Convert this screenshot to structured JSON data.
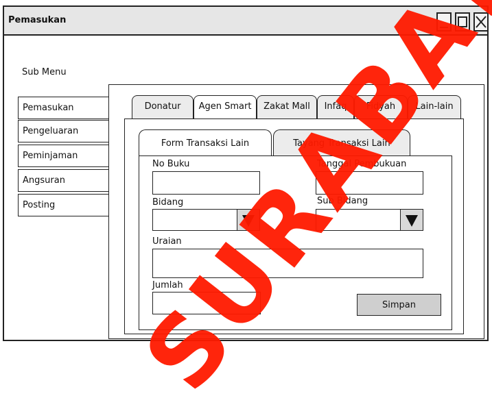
{
  "window": {
    "title": "Pemasukan"
  },
  "sidebar": {
    "label": "Sub Menu",
    "items": [
      {
        "label": "Pemasukan"
      },
      {
        "label": "Pengeluaran"
      },
      {
        "label": "Peminjaman"
      },
      {
        "label": "Angsuran"
      },
      {
        "label": "Posting"
      }
    ]
  },
  "tabs": [
    {
      "label": "Donatur"
    },
    {
      "label": "Agen Smart"
    },
    {
      "label": "Zakat Mall"
    },
    {
      "label": "Infaq"
    },
    {
      "label": "Fidyah"
    },
    {
      "label": "Lain-lain"
    }
  ],
  "subtabs": [
    {
      "label": "Form Transaksi Lain"
    },
    {
      "label": "Tayang Transaksi Lain"
    }
  ],
  "form": {
    "no_buku_label": "No Buku",
    "tanggal_label": "Tanggal Pembukuan",
    "bidang_label": "Bidang",
    "sub_bidang_label": "Sub Bidang",
    "uraian_label": "Uraian",
    "jumlah_label": "Jumlah",
    "save_label": "Simpan"
  },
  "watermark": {
    "text": "SURABAYA"
  }
}
